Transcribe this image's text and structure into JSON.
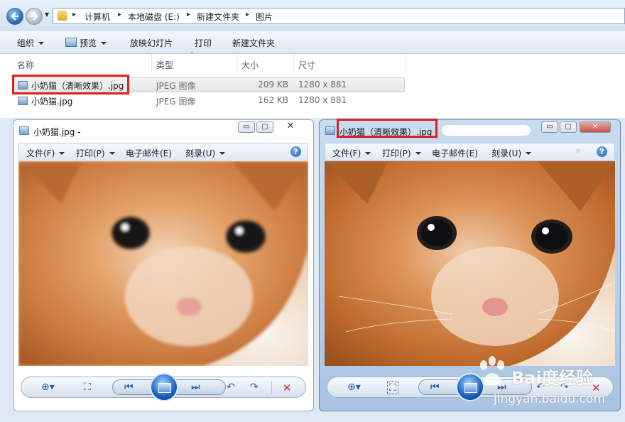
{
  "address": {
    "crumbs": [
      "计算机",
      "本地磁盘 (E:)",
      "新建文件夹",
      "图片"
    ]
  },
  "toolbar": {
    "organize": "组织",
    "preview": "预览",
    "slideshow": "放映幻灯片",
    "print": "打印",
    "new_folder": "新建文件夹"
  },
  "columns": {
    "name": "名称",
    "type": "类型",
    "size": "大小",
    "dimensions": "尺寸"
  },
  "files": [
    {
      "name": "小奶猫（清晰效果）.jpg",
      "type": "JPEG 图像",
      "size": "209 KB",
      "dimensions": "1280 x 881"
    },
    {
      "name": "小奶猫.jpg",
      "type": "JPEG 图像",
      "size": "162 KB",
      "dimensions": "1280 x 881"
    }
  ],
  "viewer_left": {
    "title": "小奶猫.jpg -",
    "menu": {
      "file": "文件(F)",
      "print": "打印(P)",
      "email": "电子邮件(E)",
      "burn": "刻录(U)"
    },
    "help": "?"
  },
  "viewer_right": {
    "title": "小奶猫（清晰效果）.jpg",
    "menu": {
      "file": "文件(F)",
      "print": "打印(P)",
      "email": "电子邮件(E)",
      "burn": "刻录(U)"
    },
    "help": "?"
  },
  "watermark": {
    "brand": "Bai度经验",
    "url": "jingyan.baidu.com"
  },
  "colors": {
    "highlight": "#e01e1e",
    "accent": "#2a5da8"
  }
}
